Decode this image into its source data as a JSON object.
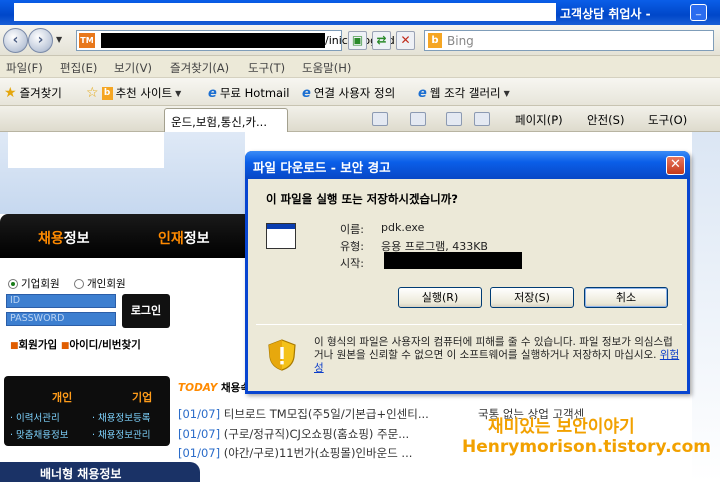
{
  "browser": {
    "title_tail": "고객상담 취업사 -",
    "address_url_tail": "/inicis/log/pd",
    "address_favicon": "TM",
    "search_placeholder": "Bing",
    "menu": [
      "파일(F)",
      "편집(E)",
      "보기(V)",
      "즐겨찾기(A)",
      "도구(T)",
      "도움말(H)"
    ],
    "favorites": {
      "label": "즐겨찾기",
      "items": [
        "추천 사이트",
        "무료 Hotmail",
        "연결 사용자 정의",
        "웹 조각 갤러리"
      ]
    },
    "tab_title": "운드,보험,통신,카...",
    "commands": [
      "페이지(P)",
      "안전(S)",
      "도구(O)"
    ]
  },
  "page": {
    "nav1": {
      "accent": "채용",
      "rest": "정보"
    },
    "nav2": {
      "accent": "인재",
      "rest": "정보"
    },
    "login": {
      "radio_company": "기업회원",
      "radio_person": "개인회원",
      "id_placeholder": "ID",
      "pw_placeholder": "PASSWORD",
      "button": "로그인",
      "join": "회원가입",
      "find": "아이디/비번찾기"
    },
    "menubox": {
      "personal": "개인",
      "company": "기업",
      "personal_links": [
        "· 이력서관리",
        "· 맞춤채용정보"
      ],
      "company_links": [
        "· 채용정보등록",
        "· 채용정보관리"
      ]
    },
    "today_label": "TODAY",
    "today_text": "채용속보",
    "jobs": [
      {
        "date": "[01/07]",
        "text": "티브로드 TM모집(주5일/기본급+인센티..."
      },
      {
        "date": "[01/07]",
        "text": "(구로/정규직)CJ오쇼핑(홈쇼핑) 주문..."
      },
      {
        "date": "[01/07]",
        "text": "(야간/구로)11번가(쇼핑몰)인바운드 ..."
      }
    ],
    "right_job": "국통 없는 상업 고객센",
    "banner": "배너형 채용정보",
    "watermark_line1": "재미있는 보안이야기",
    "watermark_line2": "Henrymorison.tistory.com"
  },
  "dialog": {
    "title": "파일 다운로드 - 보안 경고",
    "question": "이 파일을 실행 또는 저장하시겠습니까?",
    "name_label": "이름:",
    "name_value": "pdk.exe",
    "type_label": "유형:",
    "type_value": "응용 프로그램, 433KB",
    "from_label": "시작:",
    "buttons": {
      "run": "실행(R)",
      "save": "저장(S)",
      "cancel": "취소"
    },
    "warning": "이 형식의 파일은 사용자의 컴퓨터에 피해를 줄 수 있습니다. 파일 정보가 의심스럽거나 원본을 신뢰할 수 없으면 이 소프트웨어를 실행하거나 저장하지 마십시오.",
    "risk_link": "위험성"
  }
}
